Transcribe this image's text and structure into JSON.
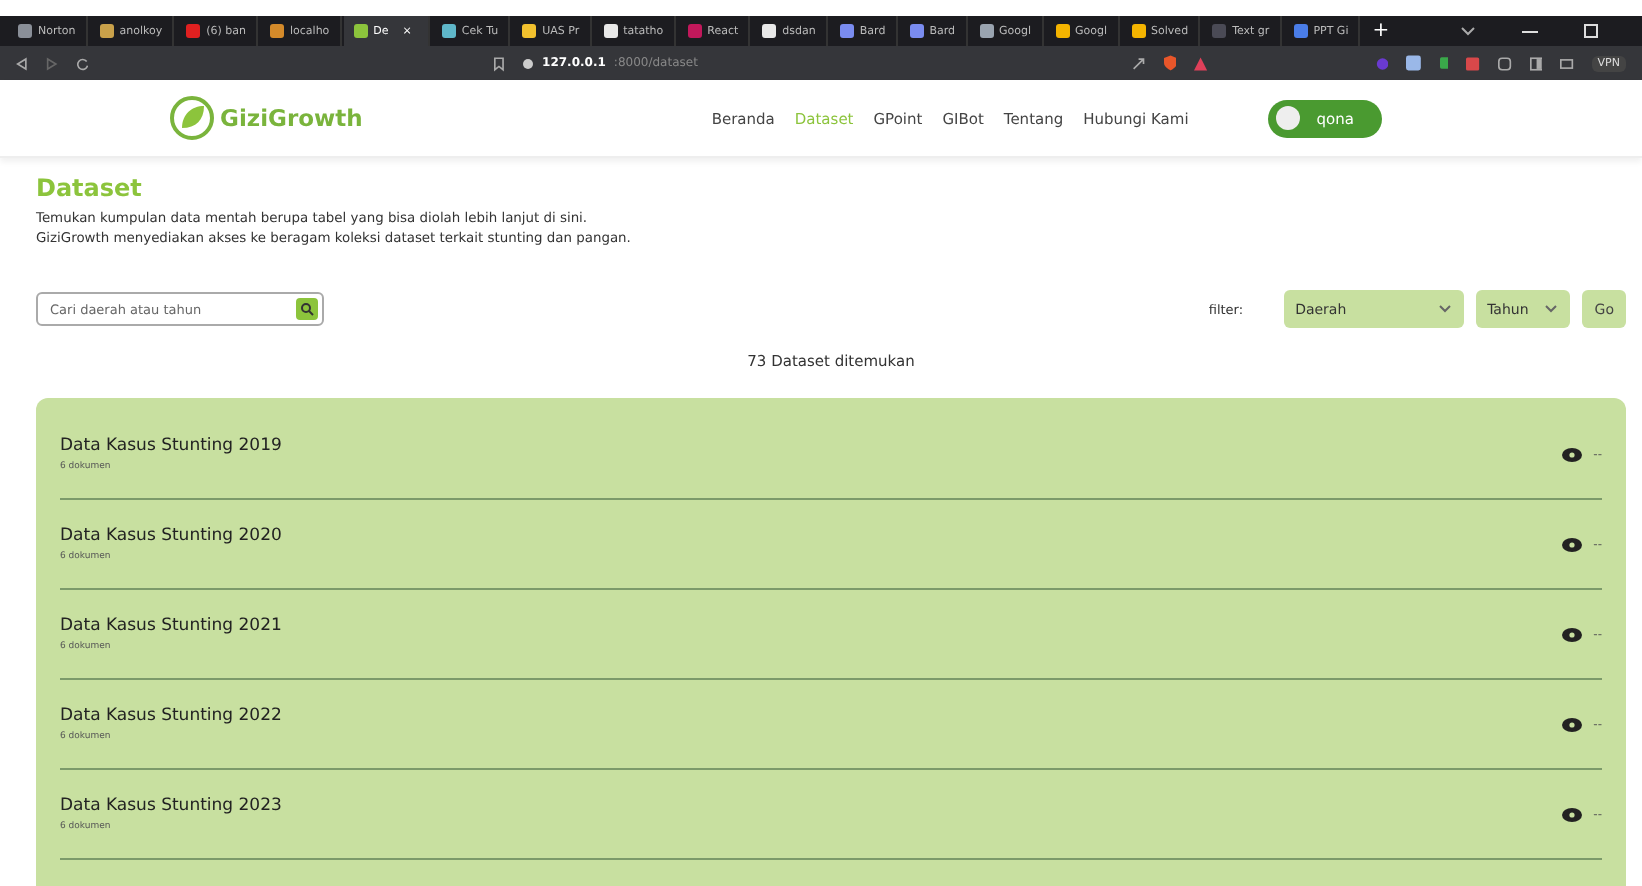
{
  "browser": {
    "tabs": [
      {
        "label": "Norton",
        "color": "#8a8f98",
        "selected": false
      },
      {
        "label": "anolkoy",
        "color": "#c9a14a",
        "selected": false
      },
      {
        "label": "(6) ban",
        "color": "#e02020",
        "selected": false
      },
      {
        "label": "localho",
        "color": "#d48a2a",
        "selected": false
      },
      {
        "label": "De",
        "color": "#8cc43c",
        "selected": true
      },
      {
        "label": "Cek Tu",
        "color": "#5fb7c9",
        "selected": false
      },
      {
        "label": "UAS Pr",
        "color": "#f2c12e",
        "selected": false
      },
      {
        "label": "tatatho",
        "color": "#e8e8e8",
        "selected": false
      },
      {
        "label": "React",
        "color": "#c2185b",
        "selected": false
      },
      {
        "label": "dsdan",
        "color": "#e8e8e8",
        "selected": false
      },
      {
        "label": "Bard",
        "color": "#7a8cf0",
        "selected": false
      },
      {
        "label": "Bard",
        "color": "#7a8cf0",
        "selected": false
      },
      {
        "label": "Googl",
        "color": "#9aa4b0",
        "selected": false
      },
      {
        "label": "Googl",
        "color": "#f4b400",
        "selected": false
      },
      {
        "label": "Solved",
        "color": "#f4b400",
        "selected": false
      },
      {
        "label": "Text gr",
        "color": "#4a4a55",
        "selected": false
      },
      {
        "label": "PPT Gi",
        "color": "#4a7de8",
        "selected": false
      }
    ],
    "close_tab": "×",
    "new_tab": "+",
    "url_host": "127.0.0.1",
    "url_path": ":8000/dataset",
    "vpn": "VPN"
  },
  "nav": {
    "brand": "GiziGrowth",
    "links": [
      {
        "label": "Beranda",
        "selected": false
      },
      {
        "label": "Dataset",
        "selected": true
      },
      {
        "label": "GPoint",
        "selected": false
      },
      {
        "label": "GIBot",
        "selected": false
      },
      {
        "label": "Tentang",
        "selected": false
      },
      {
        "label": "Hubungi Kami",
        "selected": false
      }
    ],
    "user": {
      "name": "qona",
      "on": true
    }
  },
  "page": {
    "title": "Dataset",
    "description": [
      "Temukan kumpulan data mentah berupa tabel yang bisa diolah lebih lanjut di sini.",
      "GiziGrowth menyediakan akses ke beragam koleksi dataset terkait stunting dan pangan."
    ],
    "search": {
      "placeholder": "Cari daerah atau tahun"
    },
    "filter": {
      "label": "filter:",
      "selects": [
        "Daerah",
        "Tahun"
      ],
      "go": "Go"
    },
    "count": "73 Dataset ditemukan",
    "datasets": [
      {
        "title": "Data Kasus Stunting 2019",
        "meta": "6 dokumen",
        "more": "--"
      },
      {
        "title": "Data Kasus Stunting 2020",
        "meta": "6 dokumen",
        "more": "--"
      },
      {
        "title": "Data Kasus Stunting 2021",
        "meta": "6 dokumen",
        "more": "--"
      },
      {
        "title": "Data Kasus Stunting 2022",
        "meta": "6 dokumen",
        "more": "--"
      },
      {
        "title": "Data Kasus Stunting 2023",
        "meta": "6 dokumen",
        "more": "--"
      }
    ]
  }
}
